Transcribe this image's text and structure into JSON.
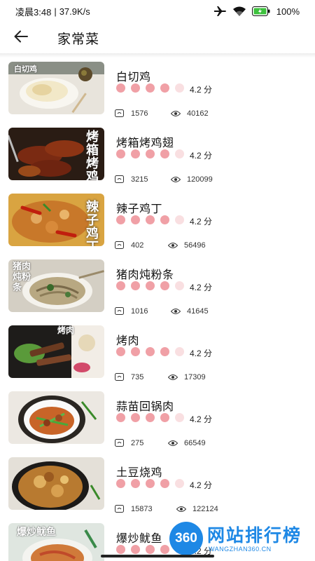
{
  "status_bar": {
    "time": "凌晨3:48",
    "separator": "|",
    "network_speed": "37.9K/s",
    "battery": "100%",
    "icons": [
      "airplane-icon",
      "wifi-icon",
      "battery-icon"
    ]
  },
  "header": {
    "back_icon": "arrow-left-icon",
    "title": "家常菜"
  },
  "colors": {
    "dot_filled": "#f0a0a6",
    "dot_empty": "#f9dfe1",
    "watermark_blue": "#1e88e5"
  },
  "dishes": [
    {
      "name": "白切鸡",
      "rating_dots": 4,
      "score": "4.2 分",
      "favorites": "1576",
      "views": "40162",
      "thumb_badge": "白切鸡",
      "thumb_vertical": ""
    },
    {
      "name": "烤箱烤鸡翅",
      "rating_dots": 4,
      "score": "4.2 分",
      "favorites": "3215",
      "views": "120099",
      "thumb_badge": "",
      "thumb_vertical": "烤箱烤鸡"
    },
    {
      "name": "辣子鸡丁",
      "rating_dots": 4,
      "score": "4.2 分",
      "favorites": "402",
      "views": "56496",
      "thumb_badge": "",
      "thumb_vertical": "辣子鸡丁"
    },
    {
      "name": "猪肉炖粉条",
      "rating_dots": 4,
      "score": "4.2 分",
      "favorites": "1016",
      "views": "41645",
      "thumb_badge": "猪肉炖粉条",
      "thumb_vertical": ""
    },
    {
      "name": "烤肉",
      "rating_dots": 4,
      "score": "4.2 分",
      "favorites": "735",
      "views": "17309",
      "thumb_badge": "烤肉",
      "thumb_vertical": ""
    },
    {
      "name": "蒜苗回锅肉",
      "rating_dots": 4,
      "score": "4.2 分",
      "favorites": "275",
      "views": "66549",
      "thumb_badge": "",
      "thumb_vertical": ""
    },
    {
      "name": "土豆烧鸡",
      "rating_dots": 4,
      "score": "4.2 分",
      "favorites": "15873",
      "views": "122124",
      "thumb_badge": "",
      "thumb_vertical": ""
    },
    {
      "name": "爆炒鱿鱼",
      "rating_dots": 4,
      "score": "4.2 分",
      "favorites": "",
      "views": "",
      "thumb_badge": "爆炒鱿鱼",
      "thumb_vertical": ""
    }
  ],
  "watermark": {
    "logo_text": "360",
    "site_name": "网站排行榜",
    "site_url": "WANGZHAN360.CN"
  }
}
